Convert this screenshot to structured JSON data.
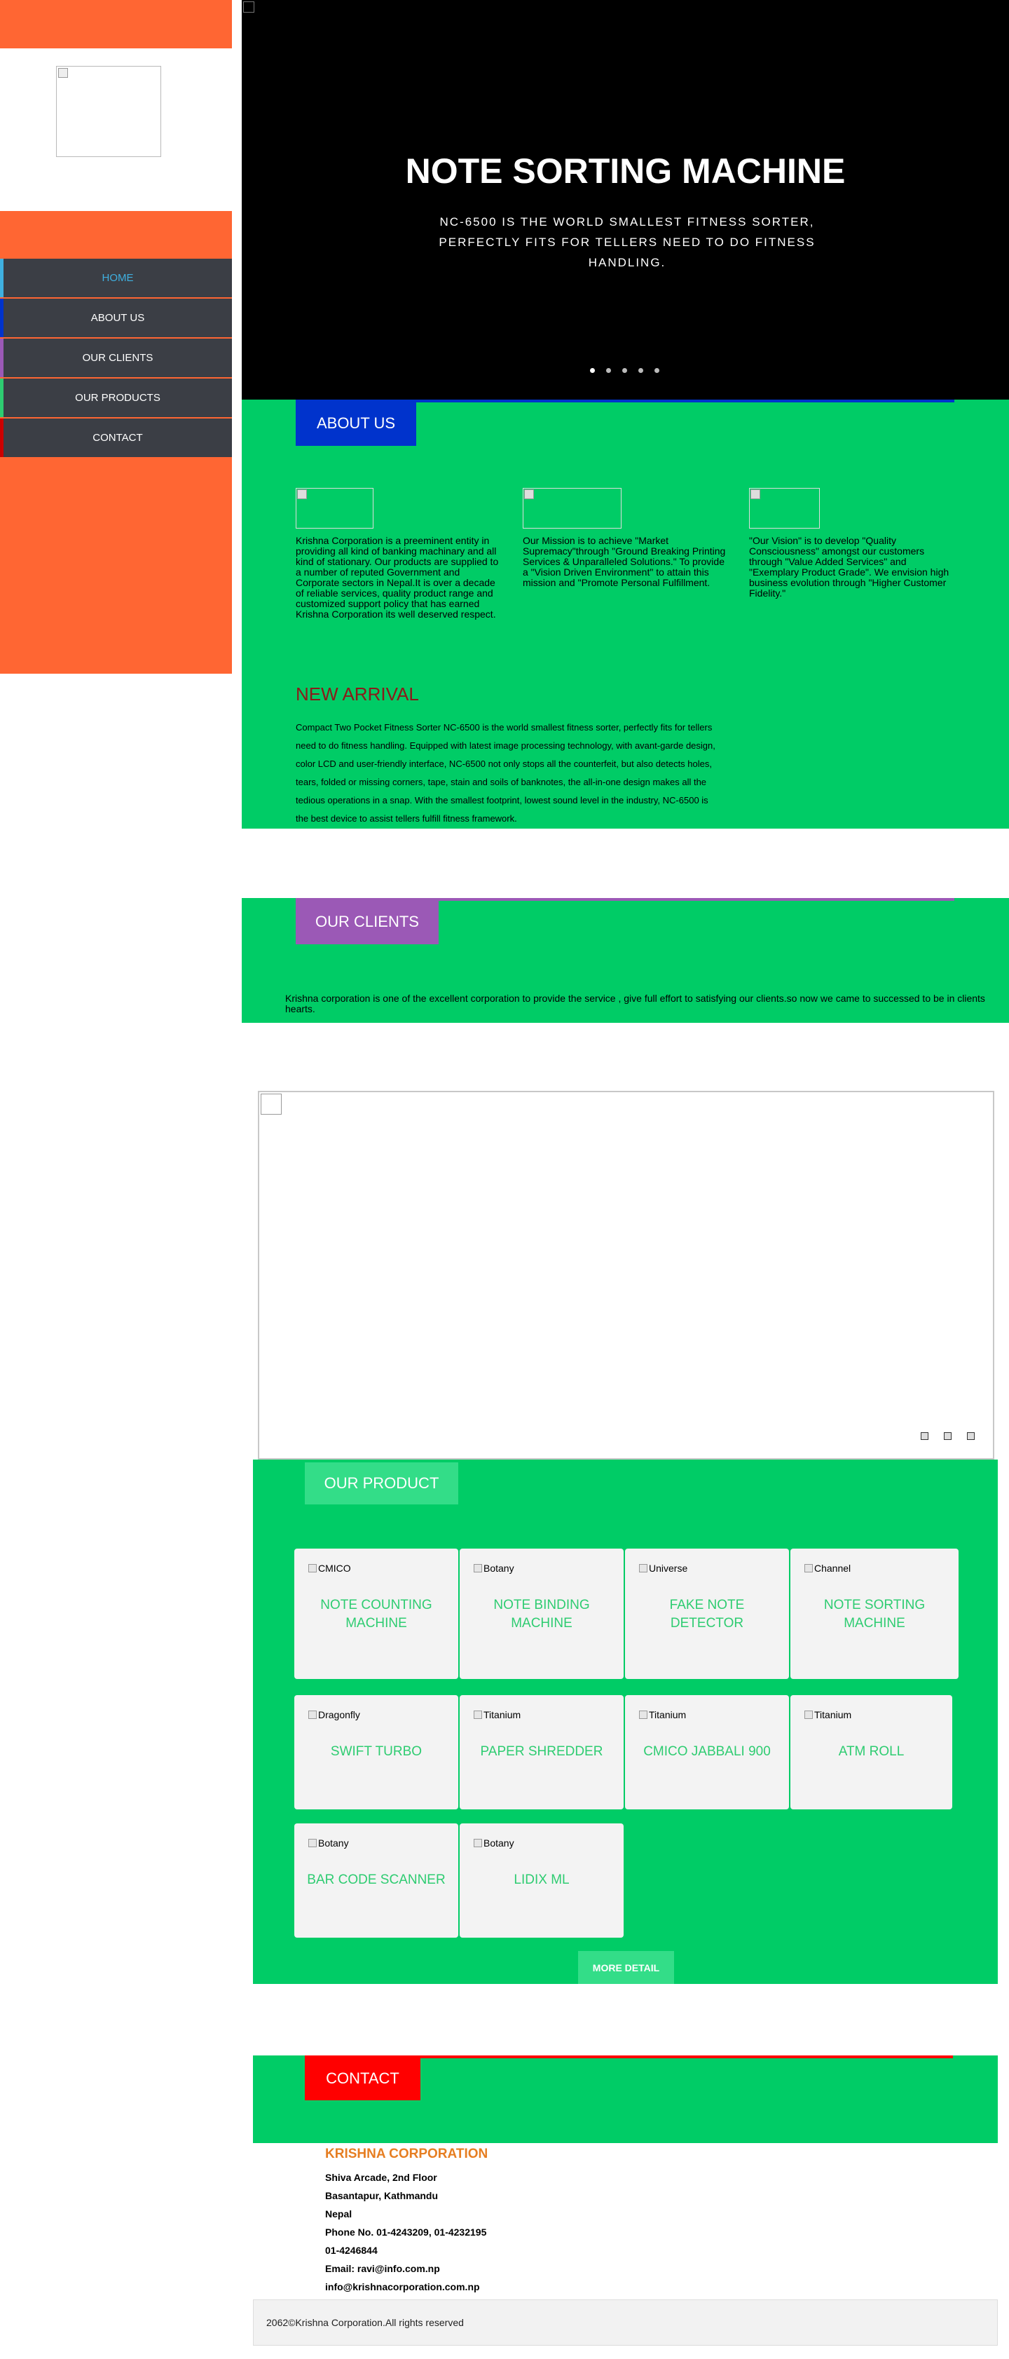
{
  "sidebar": {
    "items": [
      {
        "label": "HOME",
        "accent": "#3fb0e0",
        "active": true
      },
      {
        "label": "ABOUT US",
        "accent": "#0033cc"
      },
      {
        "label": "OUR CLIENTS",
        "accent": "#9b59b6"
      },
      {
        "label": "OUR PRODUCTS",
        "accent": "#2ecc71"
      },
      {
        "label": "CONTACT",
        "accent": "#cc0000"
      }
    ],
    "bg_color": "#ff6633"
  },
  "hero": {
    "title": "NOTE SORTING MACHINE",
    "subtitle": "NC-6500 IS THE WORLD SMALLEST FITNESS SORTER, PERFECTLY FITS FOR TELLERS NEED TO DO FITNESS HANDLING.",
    "slide_count": 5,
    "active_slide": 1
  },
  "about": {
    "tab_label": "ABOUT US",
    "tab_color": "#0033cc",
    "cards": [
      {
        "text": "Krishna Corporation is a preeminent entity in providing all kind of banking machinary and all kind of stationary. Our products are supplied to a number of reputed Government and Corporate sectors in Nepal.It is over a decade of reliable services, quality product range and customized support policy that has earned Krishna Corporation its well deserved respect."
      },
      {
        "text": "Our Mission is to achieve \"Market Supremacy\"through \"Ground Breaking Printing Services & Unparalleled Solutions.\" To provide a \"Vision Driven Environment\" to attain this mission and \"Promote Personal Fulfillment."
      },
      {
        "text": "\"Our Vision\" is to develop \"Quality Consciousness\" amongst our customers through \"Value Added Services\" and \"Exemplary Product Grade\". We envision high business evolution through \"Higher Customer Fidelity.\""
      }
    ],
    "arrival_title": "NEW ARRIVAL",
    "arrival_text": "Compact Two Pocket Fitness Sorter NC-6500 is the world smallest fitness sorter, perfectly fits for tellers need to do fitness handling. Equipped with latest image processing technology, with avant-garde design, color LCD and user-friendly interface, NC-6500 not only stops all the counterfeit, but also detects holes, tears, folded or missing corners, tape, stain and soils of banknotes, the all-in-one design makes all the tedious operations in a snap. With the smallest footprint, lowest sound level in the industry, NC-6500 is the best device to assist tellers fulfill fitness framework."
  },
  "clients": {
    "tab_label": "OUR CLIENTS",
    "tab_color": "#9b59b6",
    "text": "Krishna corporation is one of the excellent corporation to provide the service , give full effort to satisfying our clients.so now we came to successed to be in clients hearts."
  },
  "products": {
    "tab_label": "OUR PRODUCT",
    "items": [
      {
        "brand": "CMICO",
        "name": "NOTE COUNTING MACHINE"
      },
      {
        "brand": "Botany",
        "name": "NOTE BINDING MACHINE"
      },
      {
        "brand": "Universe",
        "name": "FAKE NOTE DETECTOR"
      },
      {
        "brand": "Channel",
        "name": "NOTE SORTING MACHINE"
      },
      {
        "brand": "Dragonfly",
        "name": "SWIFT TURBO"
      },
      {
        "brand": "Titanium",
        "name": "PAPER SHREDDER"
      },
      {
        "brand": "Titanium",
        "name": "CMICO JABBALI 900"
      },
      {
        "brand": "Titanium",
        "name": "ATM ROLL"
      },
      {
        "brand": "Botany",
        "name": "BAR CODE SCANNER"
      },
      {
        "brand": "Botany",
        "name": "LIDIX ML"
      }
    ],
    "more_label": "MORE DETAIL"
  },
  "contact": {
    "tab_label": "CONTACT",
    "tab_color": "#ff0000",
    "company": "KRISHNA CORPORATION",
    "lines": [
      "Shiva Arcade, 2nd Floor",
      "Basantapur, Kathmandu",
      "Nepal",
      "Phone No. 01-4243209, 01-4232195",
      "01-4246844",
      "Email: ravi@info.com.np",
      "info@krishnacorporation.com.np"
    ]
  },
  "footer": {
    "text": "2062©Krishna Corporation.All rights reserved"
  }
}
